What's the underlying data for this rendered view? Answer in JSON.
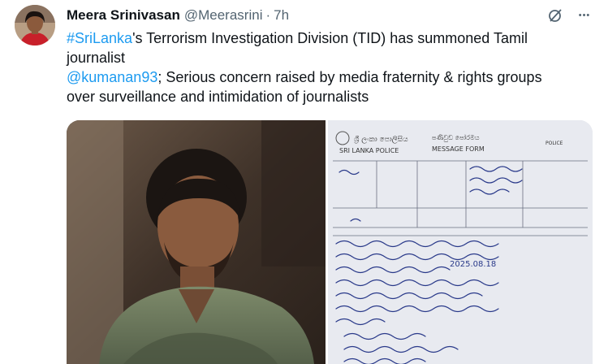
{
  "author": {
    "name": "Meera Srinivasan",
    "handle": "@Meerasrini",
    "separator": "·",
    "time": "7h"
  },
  "tweet": {
    "line1_hashtag": "#SriLanka",
    "line1_rest": "'s Terrorism Investigation Division (TID) has summoned Tamil",
    "line2": "journalist",
    "line3_mention": "@kumanan93",
    "line3_rest": "; Serious concern raised by media fraternity & rights groups",
    "line4": "over surveillance and intimidation of journalists"
  },
  "actions": {
    "grok_icon": "grok-icon",
    "more_icon": "more-icon",
    "more_glyph": "•••"
  },
  "media": {
    "left_image": "journalist-portrait-photo",
    "right_image": "police-message-form-photo",
    "form_header_sinhala": "ශ්‍රී ලංකා පොලිසිය",
    "form_header_en": "SRI LANKA POLICE",
    "form_title_sinhala": "පණිවුඩ පෝරමය",
    "form_title_en": "MESSAGE FORM",
    "form_police_label": "POLICE",
    "form_date": "2025.08.18"
  },
  "colors": {
    "link": "#1d9bf0",
    "text": "#0f1419",
    "secondary": "#536471"
  }
}
